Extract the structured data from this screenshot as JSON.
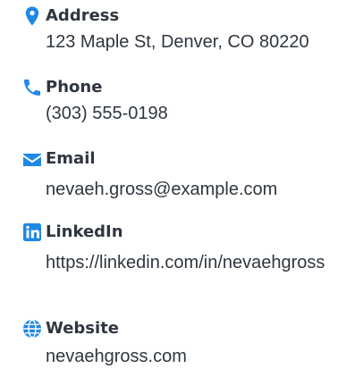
{
  "accent_color": "#1e88e5",
  "contacts": [
    {
      "icon": "map-pin-icon",
      "label": "Address",
      "value": "123 Maple St, Denver, CO 80220"
    },
    {
      "icon": "phone-icon",
      "label": "Phone",
      "value": "(303) 555-0198"
    },
    {
      "icon": "envelope-icon",
      "label": "Email",
      "value": "nevaeh.gross@example.com"
    },
    {
      "icon": "linkedin-icon",
      "label": "LinkedIn",
      "value": "https://linkedin.com/in/nevaehgross"
    },
    {
      "icon": "globe-icon",
      "label": "Website",
      "value": "nevaehgross.com"
    }
  ]
}
